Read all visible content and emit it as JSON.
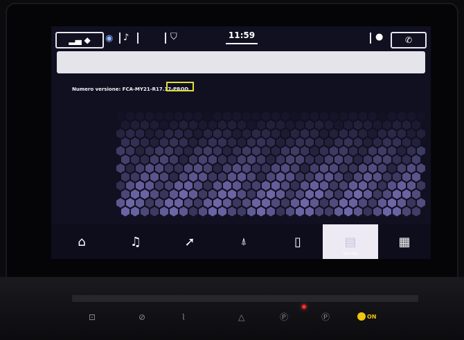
{
  "status_bar": {
    "time": "11:59",
    "left_icons": [
      "phone-signal-icon",
      "globe-icon",
      "bell-icon",
      "car-connect-icon"
    ],
    "right_icons": [
      "microphone-icon",
      "phone-icon"
    ]
  },
  "info": {
    "version_text": "Numero versione: FCA-MY21-R17.17-PROD",
    "highlighted_text": "R17.17"
  },
  "nav": {
    "items": [
      {
        "icon": "home-icon",
        "label": ""
      },
      {
        "icon": "music-note-icon",
        "label": ""
      },
      {
        "icon": "navigation-arrow-icon",
        "label": ""
      },
      {
        "icon": "person-icon",
        "label": ""
      },
      {
        "icon": "phone-device-icon",
        "label": ""
      },
      {
        "icon": "vehicle-icon",
        "label": "Veicolo"
      },
      {
        "icon": "apps-grid-icon",
        "label": ""
      }
    ],
    "active_index": 5
  },
  "console": {
    "on_label": "ON"
  },
  "colors": {
    "accent_highlight": "#e1e03a",
    "pattern": "#6d67a8",
    "led": "#ff2a2a"
  }
}
